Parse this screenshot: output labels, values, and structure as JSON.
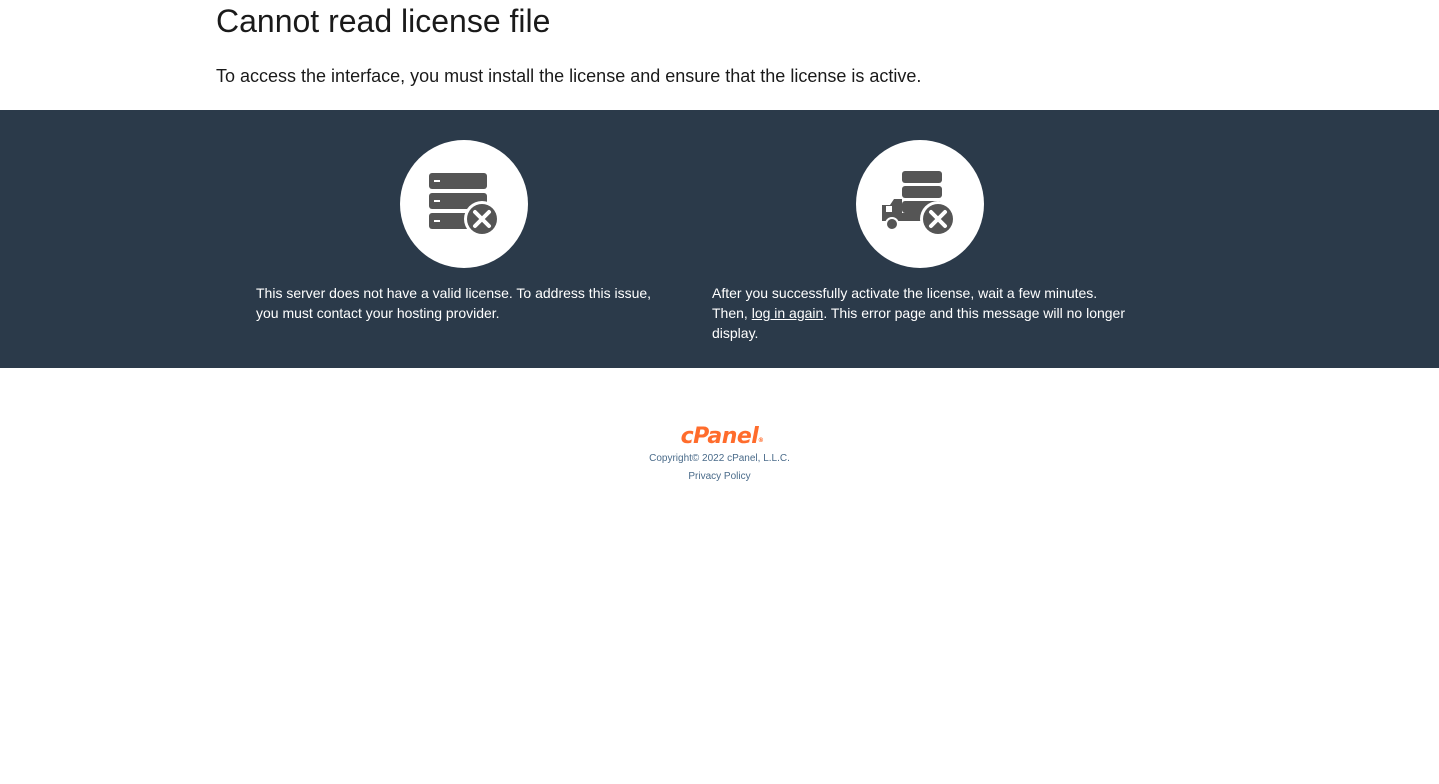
{
  "header": {
    "title": "Cannot read license file",
    "subtitle": "To access the interface, you must install the license and ensure that the license is active."
  },
  "panels": {
    "left": {
      "icon": "server-error-icon",
      "text": "This server does not have a valid license. To address this issue, you must contact your hosting provider."
    },
    "right": {
      "icon": "server-delivery-error-icon",
      "text_before": "After you successfully activate the license, wait a few minutes. Then, ",
      "link_label": "log in again",
      "text_after": ". This error page and this message will no longer display."
    }
  },
  "footer": {
    "logo_text": "cPanel",
    "logo_mark": "®",
    "copyright": "Copyright© 2022 cPanel, L.L.C.",
    "privacy_label": "Privacy Policy"
  },
  "colors": {
    "band_background": "#2b3a4a",
    "icon_gray": "#555555",
    "logo_orange": "#ff6c2c",
    "footer_link": "#4a6b8a"
  }
}
